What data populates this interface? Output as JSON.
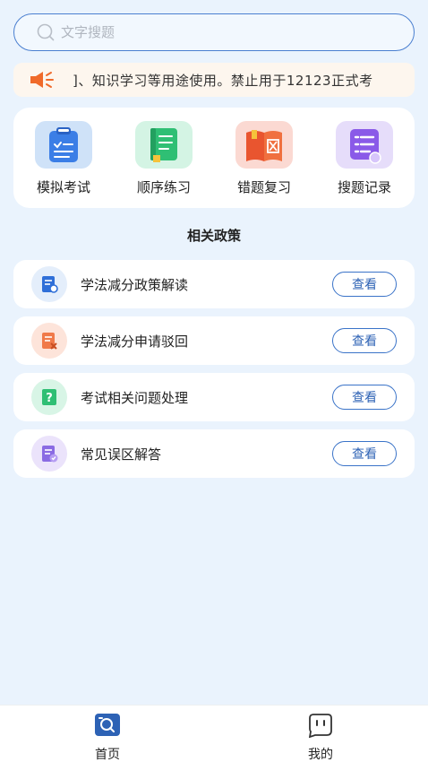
{
  "search": {
    "placeholder": "文字搜题"
  },
  "notice": {
    "text": "]、知识学习等用途使用。禁止用于12123正式考"
  },
  "quick_actions": [
    {
      "label": "模拟考试",
      "icon": "clipboard-icon"
    },
    {
      "label": "顺序练习",
      "icon": "notebook-icon"
    },
    {
      "label": "错题复习",
      "icon": "wrong-book-icon"
    },
    {
      "label": "搜题记录",
      "icon": "record-list-icon"
    }
  ],
  "policy_section": {
    "title": "相关政策",
    "items": [
      {
        "title": "学法减分政策解读",
        "button": "查看",
        "icon": "document-search-icon"
      },
      {
        "title": "学法减分申请驳回",
        "button": "查看",
        "icon": "document-reject-icon"
      },
      {
        "title": "考试相关问题处理",
        "button": "查看",
        "icon": "question-icon"
      },
      {
        "title": "常见误区解答",
        "button": "查看",
        "icon": "document-check-icon"
      }
    ]
  },
  "tabbar": {
    "home": "首页",
    "mine": "我的"
  },
  "colors": {
    "accent": "#2d62b5",
    "background": "#eaf3fd",
    "notice_bg": "#fdf6ee",
    "speaker": "#f06a2a"
  }
}
